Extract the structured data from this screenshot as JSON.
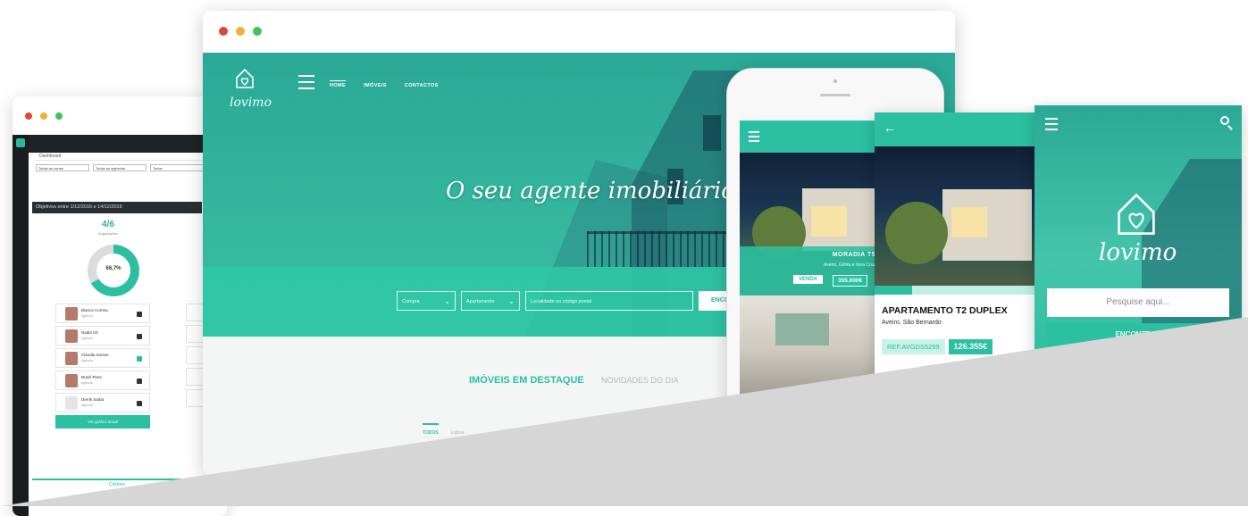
{
  "dashboard": {
    "breadcrumb": "Dashboard",
    "filters": [
      "Todas as zonas",
      "Todas as agências",
      "Todos"
    ],
    "panel_title": "Objetivos entre 1/12/2016 e 14/12/2016",
    "ratio": "4/6",
    "ratio_label": "Angariações",
    "donut_value": 0.667,
    "donut_label": "66,7%",
    "agents": [
      {
        "name": "Bianca Correia",
        "role": "Agência",
        "done": false
      },
      {
        "name": "Nadia Gil",
        "role": "Agência",
        "done": false
      },
      {
        "name": "Cláudia Santos",
        "role": "Agência",
        "done": true
      },
      {
        "name": "Brazil Pires",
        "role": "Agência",
        "done": false
      },
      {
        "name": "Derrik Sadat",
        "role": "Agência",
        "done": false
      }
    ],
    "chart_button": "Ver gráfico anual",
    "footer_tab": "Clientes"
  },
  "website": {
    "logo": "lovimo",
    "nav": [
      "HOME",
      "IMÓVEIS",
      "CONTACTOS"
    ],
    "tagline": "O seu agente imobiliário",
    "search": {
      "type": "Compra",
      "property": "Apartamento",
      "location_placeholder": "Localidade ou código postal",
      "button": "ENCO"
    },
    "section_primary": "IMÓVEIS EM DESTAQUE",
    "section_secondary": "NOVIDADES DO DIA",
    "tabs": [
      "TODOS",
      "Lisboa"
    ]
  },
  "phone_list": {
    "card_title": "MORADIA T5",
    "card_location": "Aveiro, Glória e Vera Cruz",
    "badge": "VENDA",
    "price": "355.000€"
  },
  "detail": {
    "title": "APARTAMENTO T2 DUPLEX",
    "location": "Aveiro, São Bernardo",
    "ref": "REF.AVGDS5299",
    "price": "126.355€"
  },
  "search_screen": {
    "logo": "lovimo",
    "placeholder": "Pesquise aqui...",
    "button": "ENCONTRAR"
  },
  "colors": {
    "accent": "#2bc0a2",
    "accent_dark": "#2aa996",
    "overlay": "#d6d6d6"
  }
}
